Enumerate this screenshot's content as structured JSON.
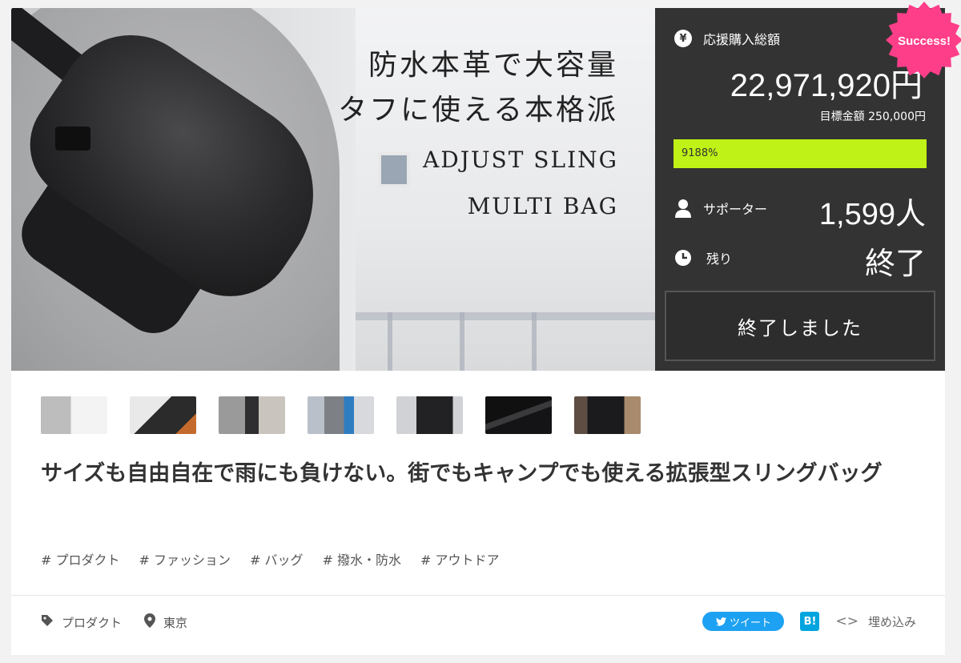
{
  "hero": {
    "title_line1": "防水本革で大容量",
    "title_line2": "タフに使える本格派",
    "subtitle_line1": "ADJUST SLING",
    "subtitle_line2": "MULTI BAG"
  },
  "panel": {
    "total_label": "応援購入総額",
    "total_amount": "22,971,920円",
    "target": "目標金額 250,000円",
    "progress_text": "9188%",
    "progress_fraction": 1.0,
    "progress_color": "#bff216",
    "supporters_label": "サポーター",
    "supporters_value": "1,599人",
    "remaining_label": "残り",
    "remaining_value": "終了",
    "button_label": "終了しました",
    "yen_icon": "¥"
  },
  "badge": {
    "label": "Success!",
    "color": "#ff3e8a"
  },
  "thumbnails": [
    {
      "name": "thumb-1"
    },
    {
      "name": "thumb-2"
    },
    {
      "name": "thumb-3"
    },
    {
      "name": "thumb-4"
    },
    {
      "name": "thumb-5"
    },
    {
      "name": "thumb-6"
    },
    {
      "name": "thumb-7"
    }
  ],
  "product_title": "サイズも自由自在で雨にも負けない。街でもキャンプでも使える拡張型スリングバッグ",
  "tags": [
    "# プロダクト",
    "# ファッション",
    "# バッグ",
    "# 撥水・防水",
    "# アウトドア"
  ],
  "footer": {
    "category": "プロダクト",
    "location": "東京",
    "tweet": "ツイート",
    "hatena": "B!",
    "embed": "埋め込み"
  }
}
